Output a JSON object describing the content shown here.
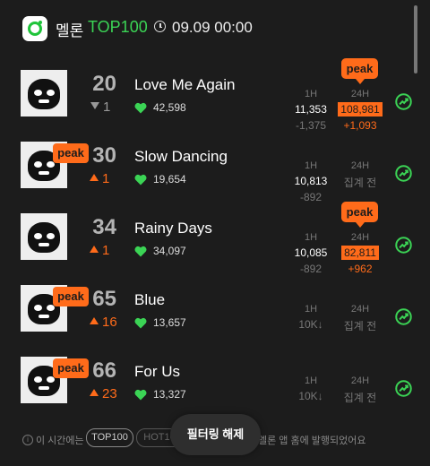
{
  "header": {
    "brand": "멜론",
    "chart_name": "TOP100",
    "time": "09.09 00:00"
  },
  "columns": {
    "h1": "1H",
    "h24": "24H"
  },
  "peak_label": "peak",
  "colors": {
    "accent": "#3bd455",
    "peak": "#ff6b1a",
    "background": "#1c1c1c"
  },
  "songs": [
    {
      "rank": "20",
      "change": "1",
      "change_dir": "down",
      "title": "Love Me Again",
      "likes": "42,598",
      "h1_value": "11,353",
      "h1_delta": "-1,375",
      "h24_value": "108,981",
      "h24_delta": "+1,093",
      "peak_badge": false,
      "peak_bubble": true
    },
    {
      "rank": "30",
      "change": "1",
      "change_dir": "up",
      "title": "Slow Dancing",
      "likes": "19,654",
      "h1_value": "10,813",
      "h1_delta": "-892",
      "h24_value": "집계 전",
      "h24_delta": "",
      "peak_badge": true,
      "peak_bubble": false
    },
    {
      "rank": "34",
      "change": "1",
      "change_dir": "up",
      "title": "Rainy Days",
      "likes": "34,097",
      "h1_value": "10,085",
      "h1_delta": "-892",
      "h24_value": "82,811",
      "h24_delta": "+962",
      "peak_badge": false,
      "peak_bubble": true
    },
    {
      "rank": "65",
      "change": "16",
      "change_dir": "up",
      "title": "Blue",
      "likes": "13,657",
      "h1_value": "10K↓",
      "h1_delta": "",
      "h24_value": "집계 전",
      "h24_delta": "",
      "peak_badge": true,
      "peak_bubble": false
    },
    {
      "rank": "66",
      "change": "23",
      "change_dir": "up",
      "title": "For Us",
      "likes": "13,327",
      "h1_value": "10K↓",
      "h1_delta": "",
      "h24_value": "집계 전",
      "h24_delta": "",
      "peak_badge": true,
      "peak_bubble": false
    }
  ],
  "footer": {
    "info_prefix": "이 시간에는",
    "pill_top100": "TOP100",
    "pill_hot": "HOT10",
    "info_suffix": "멜론 앱 홈에 발행되었어요",
    "toast": "필터링 해제"
  }
}
